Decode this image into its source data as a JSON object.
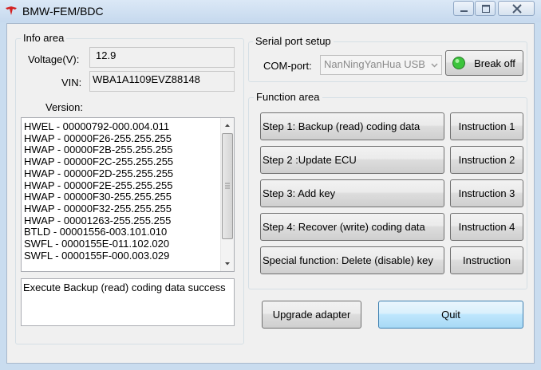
{
  "window": {
    "title": "BMW-FEM/BDC",
    "controls": [
      "minimize",
      "maximize",
      "close"
    ]
  },
  "info_area": {
    "title": "Info area",
    "voltage_label": "Voltage(V):",
    "voltage_value": "12.9",
    "vin_label": "VIN:",
    "vin_value": "WBA1A1109EVZ88148",
    "version_label": "Version:",
    "version_lines": [
      "HWEL - 00000792-000.004.011",
      "HWAP - 00000F26-255.255.255",
      "HWAP - 00000F2B-255.255.255",
      "HWAP - 00000F2C-255.255.255",
      "HWAP - 00000F2D-255.255.255",
      "HWAP - 00000F2E-255.255.255",
      "HWAP - 00000F30-255.255.255",
      "HWAP - 00000F32-255.255.255",
      "HWAP - 00001263-255.255.255",
      "BTLD - 00001556-003.101.010",
      "SWFL - 0000155E-011.102.020",
      "SWFL - 0000155F-000.003.029"
    ],
    "status_message": "Execute Backup (read) coding data success"
  },
  "serial_port": {
    "title": "Serial port setup",
    "com_label": "COM-port:",
    "com_selected": "NanNingYanHua USB",
    "break_off_label": "Break off",
    "indicator_color": "#3cc43c"
  },
  "function_area": {
    "title": "Function area",
    "rows": [
      {
        "step": "Step 1: Backup (read) coding data",
        "instruction": "Instruction 1"
      },
      {
        "step": "Step 2 :Update ECU",
        "instruction": "Instruction 2"
      },
      {
        "step": "Step 3: Add key",
        "instruction": "Instruction 3"
      },
      {
        "step": "Step 4: Recover (write) coding data",
        "instruction": "Instruction 4"
      },
      {
        "step": "Special function: Delete (disable) key",
        "instruction": "Instruction"
      }
    ]
  },
  "bottom": {
    "upgrade_label": "Upgrade adapter",
    "quit_label": "Quit"
  }
}
